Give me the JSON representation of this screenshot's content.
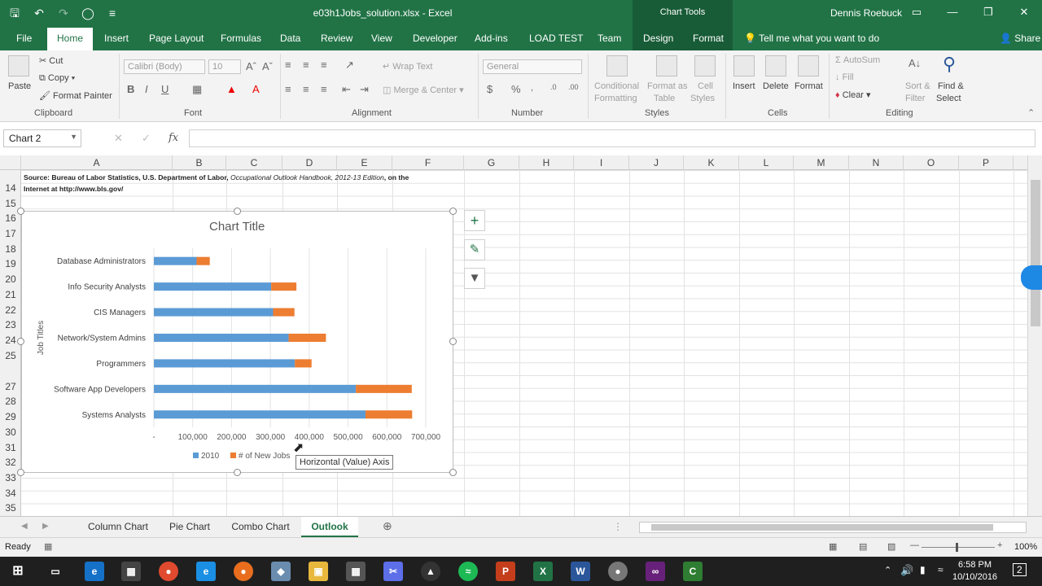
{
  "window": {
    "title": "e03h1Jobs_solution.xlsx - Excel",
    "context_tools": "Chart Tools",
    "user": "Dennis Roebuck"
  },
  "tabs": [
    "File",
    "Home",
    "Insert",
    "Page Layout",
    "Formulas",
    "Data",
    "Review",
    "View",
    "Developer",
    "Add-ins",
    "LOAD TEST",
    "Team",
    "Design",
    "Format"
  ],
  "active_tab": "Home",
  "tell_me": "Tell me what you want to do",
  "share": "Share",
  "ribbon": {
    "clipboard": {
      "paste": "Paste",
      "cut": "Cut",
      "copy": "Copy",
      "format_painter": "Format Painter",
      "label": "Clipboard"
    },
    "font": {
      "name": "Calibri (Body)",
      "size": "10",
      "label": "Font"
    },
    "alignment": {
      "wrap": "Wrap Text",
      "merge": "Merge & Center",
      "label": "Alignment"
    },
    "number": {
      "format": "General",
      "label": "Number"
    },
    "styles": {
      "conditional": "Conditional",
      "conditional2": "Formatting",
      "format_as": "Format as",
      "table": "Table",
      "cell": "Cell",
      "cell_styles": "Styles",
      "label": "Styles"
    },
    "cells": {
      "insert": "Insert",
      "delete": "Delete",
      "format": "Format",
      "label": "Cells"
    },
    "editing": {
      "autosum": "AutoSum",
      "fill": "Fill",
      "clear": "Clear",
      "sort": "Sort &",
      "filter": "Filter",
      "find": "Find &",
      "select": "Select",
      "label": "Editing"
    }
  },
  "formula_bar": {
    "name_box": "Chart 2",
    "fx": "fx"
  },
  "grid": {
    "columns": [
      "A",
      "B",
      "C",
      "D",
      "E",
      "F",
      "G",
      "H",
      "I",
      "J",
      "K",
      "L",
      "M",
      "N",
      "O",
      "P"
    ],
    "rows": [
      "14",
      "15",
      "16",
      "17",
      "18",
      "19",
      "20",
      "21",
      "22",
      "23",
      "24",
      "25",
      "27",
      "28",
      "29",
      "30",
      "31",
      "32",
      "33",
      "34",
      "35"
    ],
    "source_line1": "Source: Bureau of Labor Statistics, U.S. Department of Labor,",
    "source_italic": "Occupational Outlook Handbook, 2012-13 Edition",
    "source_line1_end": ", on the",
    "source_line2": "Internet at http://www.bls.gov/"
  },
  "chart_data": {
    "type": "bar",
    "title": "Chart Title",
    "ylabel": "Job Titles",
    "xlabel": "",
    "categories": [
      "Database Administrators",
      "Info Security Analysts",
      "CIS Managers",
      "Network/System Admins",
      "Programmers",
      "Software App Developers",
      "Systems Analysts"
    ],
    "series": [
      {
        "name": "2010",
        "values": [
          110000,
          302000,
          307000,
          347000,
          363000,
          520000,
          545000
        ]
      },
      {
        "name": "# of New Jobs",
        "values": [
          34000,
          65000,
          55000,
          96000,
          43000,
          144000,
          120000
        ]
      }
    ],
    "stacked": true,
    "xlim": [
      0,
      700000
    ],
    "xticks": [
      "-",
      "100,000",
      "200,000",
      "300,000",
      "400,000",
      "500,000",
      "600,000",
      "700,000"
    ],
    "grid": true,
    "legend": "bottom",
    "colors": {
      "2010": "#5b9bd5",
      "# of New Jobs": "#ed7d31"
    }
  },
  "tooltip": "Horizontal (Value) Axis",
  "sheet_tabs": [
    "Column Chart",
    "Pie Chart",
    "Combo Chart",
    "Outlook"
  ],
  "active_sheet": "Outlook",
  "status": {
    "ready": "Ready",
    "zoom": "100%"
  },
  "clock": {
    "time": "6:58 PM",
    "date": "10/10/2016"
  },
  "notification_count": "2"
}
